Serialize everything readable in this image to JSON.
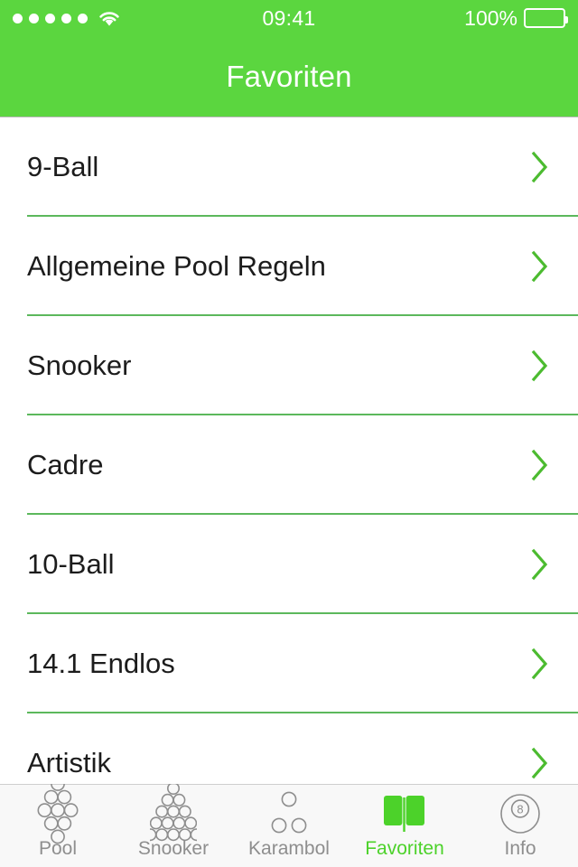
{
  "statusbar": {
    "signal_icon": "signal-dots-icon",
    "signal_dots": 5,
    "wifi_icon": "wifi-icon",
    "time": "09:41",
    "battery_percent": "100%",
    "battery_icon": "battery-full-icon",
    "battery_level": 100
  },
  "navbar": {
    "title": "Favoriten"
  },
  "colors": {
    "brand_green": "#5bd63f",
    "separator_green": "#5cb85c",
    "accent_green": "#4cd22a",
    "chevron_green": "#4cbb30",
    "tab_inactive": "#8e8e8e",
    "tabbar_bg": "#f8f8f8",
    "row_text": "#1c1c1c"
  },
  "list": {
    "chevron_icon": "chevron-right-icon",
    "items": [
      {
        "label": "9-Ball"
      },
      {
        "label": "Allgemeine Pool Regeln"
      },
      {
        "label": "Snooker"
      },
      {
        "label": "Cadre"
      },
      {
        "label": "10-Ball"
      },
      {
        "label": "14.1 Endlos"
      },
      {
        "label": "Artistik"
      }
    ]
  },
  "tabbar": {
    "items": [
      {
        "label": "Pool",
        "icon": "pool-rack-diamond-icon",
        "active": false
      },
      {
        "label": "Snooker",
        "icon": "snooker-rack-triangle-icon",
        "active": false
      },
      {
        "label": "Karambol",
        "icon": "carom-three-balls-icon",
        "active": false
      },
      {
        "label": "Favoriten",
        "icon": "open-book-icon",
        "active": true
      },
      {
        "label": "Info",
        "icon": "eight-ball-icon",
        "active": false
      }
    ]
  }
}
